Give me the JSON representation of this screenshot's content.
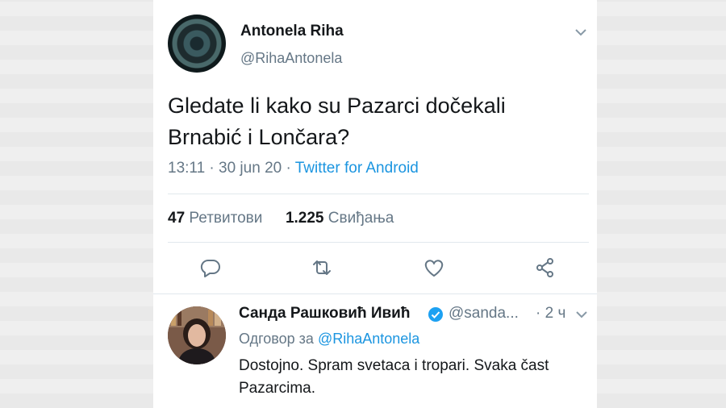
{
  "tweet": {
    "author_name": "Antonela Riha",
    "author_handle": "@RihaAntonela",
    "text": "Gledate li kako su Pazarci dočekali Brnabić i Lončara?",
    "time": "13:11 · 30 jun 20 · ",
    "source": "Twitter for Android",
    "retweets_count": "47",
    "retweets_label": "Ретвитови",
    "likes_count": "1.225",
    "likes_label": "Свиђања"
  },
  "reply": {
    "author_name": "Санда Рашковић Ивић",
    "author_handle": "@sanda...",
    "time": "· 2 ч",
    "reply_to_label": "Одговор за ",
    "reply_to_handle": "@RihaAntonela",
    "text": "Dostojno. Spram svetaca i tropari. Svaka čast Pazarcima."
  },
  "colors": {
    "accent": "#1b95e0",
    "secondary_text": "#657786",
    "primary_text": "#14171a"
  },
  "icons": [
    "chevron-down-icon",
    "reply-icon",
    "retweet-icon",
    "like-icon",
    "share-icon",
    "verified-icon"
  ]
}
